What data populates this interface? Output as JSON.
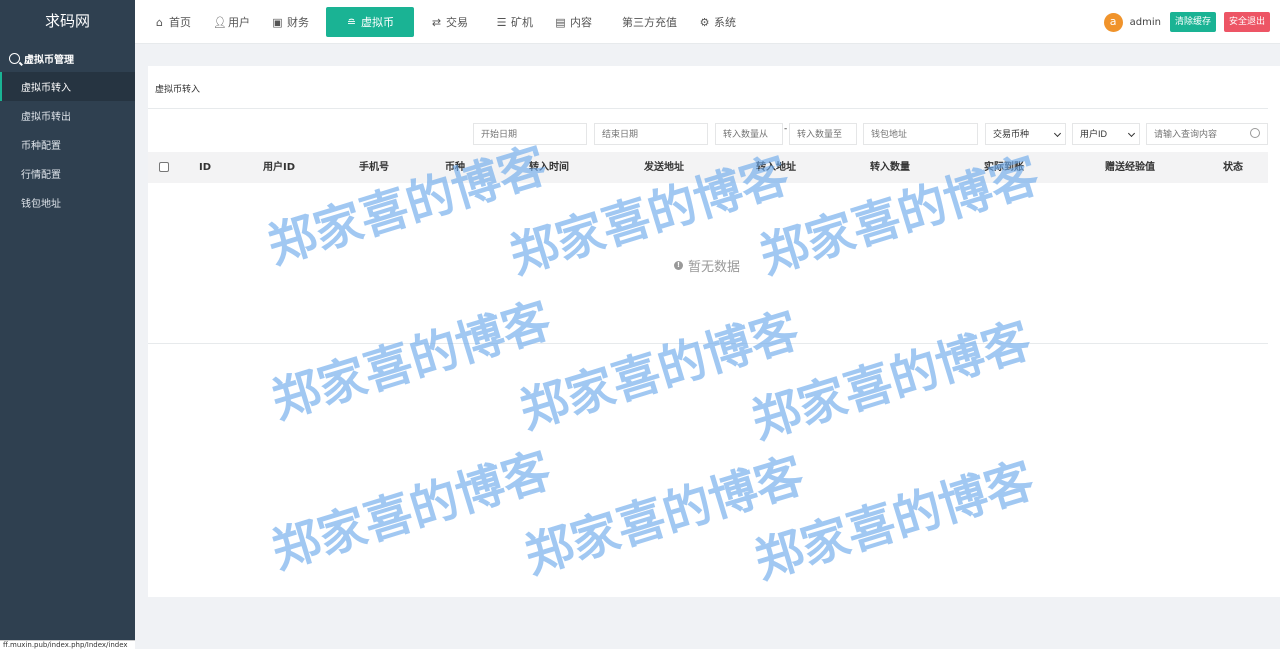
{
  "sidebar": {
    "logo": "求码网",
    "group_label": "虚拟币管理",
    "items": [
      {
        "label": "虚拟币转入"
      },
      {
        "label": "虚拟币转出"
      },
      {
        "label": "币种配置"
      },
      {
        "label": "行情配置"
      },
      {
        "label": "钱包地址"
      }
    ]
  },
  "topnav": {
    "items": [
      {
        "label": "首页",
        "icon": "home-icon"
      },
      {
        "label": "用户",
        "icon": "user-icon"
      },
      {
        "label": "财务",
        "icon": "finance-icon"
      },
      {
        "label": "虚拟币",
        "icon": "database-icon"
      },
      {
        "label": "交易",
        "icon": "exchange-icon"
      },
      {
        "label": "矿机",
        "icon": "server-icon"
      },
      {
        "label": "内容",
        "icon": "document-icon"
      },
      {
        "label": "第三方充值",
        "icon": ""
      },
      {
        "label": "系统",
        "icon": "gear-icon"
      }
    ],
    "active_index": 3
  },
  "user": {
    "avatar_letter": "a",
    "name": "admin",
    "clear_cache_label": "清除缓存",
    "logout_label": "安全退出"
  },
  "page": {
    "title": "虚拟币转入"
  },
  "filters": {
    "start_date_placeholder": "开始日期",
    "end_date_placeholder": "结束日期",
    "amount_from_placeholder": "转入数量从",
    "range_dash": "-",
    "amount_to_placeholder": "转入数量至",
    "wallet_placeholder": "钱包地址",
    "coin_select": "交易币种",
    "field_select": "用户ID",
    "search_placeholder": "请输入查询内容"
  },
  "table": {
    "columns": [
      "ID",
      "用户ID",
      "手机号",
      "币种",
      "转入时间",
      "发送地址",
      "转入地址",
      "转入数量",
      "实际到账",
      "赠送经验值",
      "状态"
    ],
    "empty_text": "暂无数据"
  },
  "watermark_text": "郑家喜的博客",
  "statusbar_url": "ff.muxin.pub/index.php/Index/index",
  "colors": {
    "sidebar_bg": "#2f4050",
    "accent": "#1ab394",
    "danger": "#ed5565",
    "avatar": "#f0932b"
  }
}
